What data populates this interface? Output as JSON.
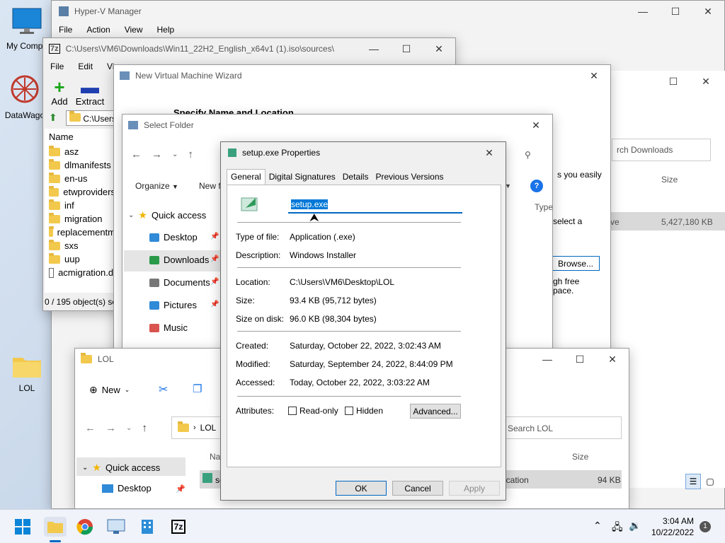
{
  "desktop": {
    "icons": [
      {
        "label": "My Compu",
        "icon": "monitor-icon"
      },
      {
        "label": "DataWago",
        "icon": "datawagon-icon"
      },
      {
        "label": "LOL",
        "icon": "folder-icon"
      }
    ]
  },
  "hyperv": {
    "title": "Hyper-V Manager",
    "menu": [
      "File",
      "Action",
      "View",
      "Help"
    ]
  },
  "sevenzip": {
    "title": "C:\\Users\\VM6\\Downloads\\Win11_22H2_English_x64v1 (1).iso\\sources\\",
    "menu": [
      "File",
      "Edit",
      "View"
    ],
    "tools": [
      "Add",
      "Extract"
    ],
    "address": "C:\\Users",
    "column_name": "Name",
    "files": [
      "asz",
      "dlmanifests",
      "en-us",
      "etwproviders",
      "inf",
      "migration",
      "replacementm",
      "sxs",
      "uup",
      "acmigration.dl"
    ],
    "status": "0 / 195 object(s) se"
  },
  "wizard": {
    "title": "New Virtual Machine Wizard",
    "heading": "Specify Name and Location",
    "text1": "s you easily",
    "text2": "select a",
    "browse": "Browse...",
    "text3": "gh free",
    "text4": "pace."
  },
  "downloads_bg": {
    "search": "rch Downloads",
    "col_size": "Size",
    "row_partial": "ve",
    "row_size": "5,427,180 KB"
  },
  "select_folder": {
    "title": "Select Folder",
    "organize": "Organize",
    "new_folder": "New f",
    "col_type": "Type",
    "quick_access": "Quick access",
    "nav": [
      {
        "label": "Desktop",
        "icon": "desktop-icon"
      },
      {
        "label": "Downloads",
        "icon": "download-icon"
      },
      {
        "label": "Documents",
        "icon": "document-icon"
      },
      {
        "label": "Pictures",
        "icon": "picture-icon"
      },
      {
        "label": "Music",
        "icon": "music-icon"
      }
    ]
  },
  "lol": {
    "title": "LOL",
    "new_label": "New",
    "path": "LOL",
    "search": "Search LOL",
    "col_name": "Na",
    "col_size": "Size",
    "row_name": "se",
    "row_type": "ocation",
    "row_size": "94 KB",
    "quick_access": "Quick access",
    "desktop": "Desktop"
  },
  "props": {
    "title": "setup.exe Properties",
    "tabs": [
      "General",
      "Digital Signatures",
      "Details",
      "Previous Versions"
    ],
    "filename": "setup.exe",
    "group1": [
      {
        "label": "Type of file:",
        "value": "Application (.exe)"
      },
      {
        "label": "Description:",
        "value": "Windows Installer"
      }
    ],
    "group2": [
      {
        "label": "Location:",
        "value": "C:\\Users\\VM6\\Desktop\\LOL"
      },
      {
        "label": "Size:",
        "value": "93.4 KB (95,712 bytes)"
      },
      {
        "label": "Size on disk:",
        "value": "96.0 KB (98,304 bytes)"
      }
    ],
    "group3": [
      {
        "label": "Created:",
        "value": "Saturday, October 22, 2022, 3:02:43 AM"
      },
      {
        "label": "Modified:",
        "value": "Saturday, September 24, 2022, 8:44:09 PM"
      },
      {
        "label": "Accessed:",
        "value": "Today, October 22, 2022, 3:03:22 AM"
      }
    ],
    "attributes_label": "Attributes:",
    "readonly": "Read-only",
    "hidden": "Hidden",
    "advanced": "Advanced...",
    "ok": "OK",
    "cancel": "Cancel",
    "apply": "Apply"
  },
  "taskbar": {
    "time": "3:04 AM",
    "date": "10/22/2022",
    "notification_count": "1"
  }
}
